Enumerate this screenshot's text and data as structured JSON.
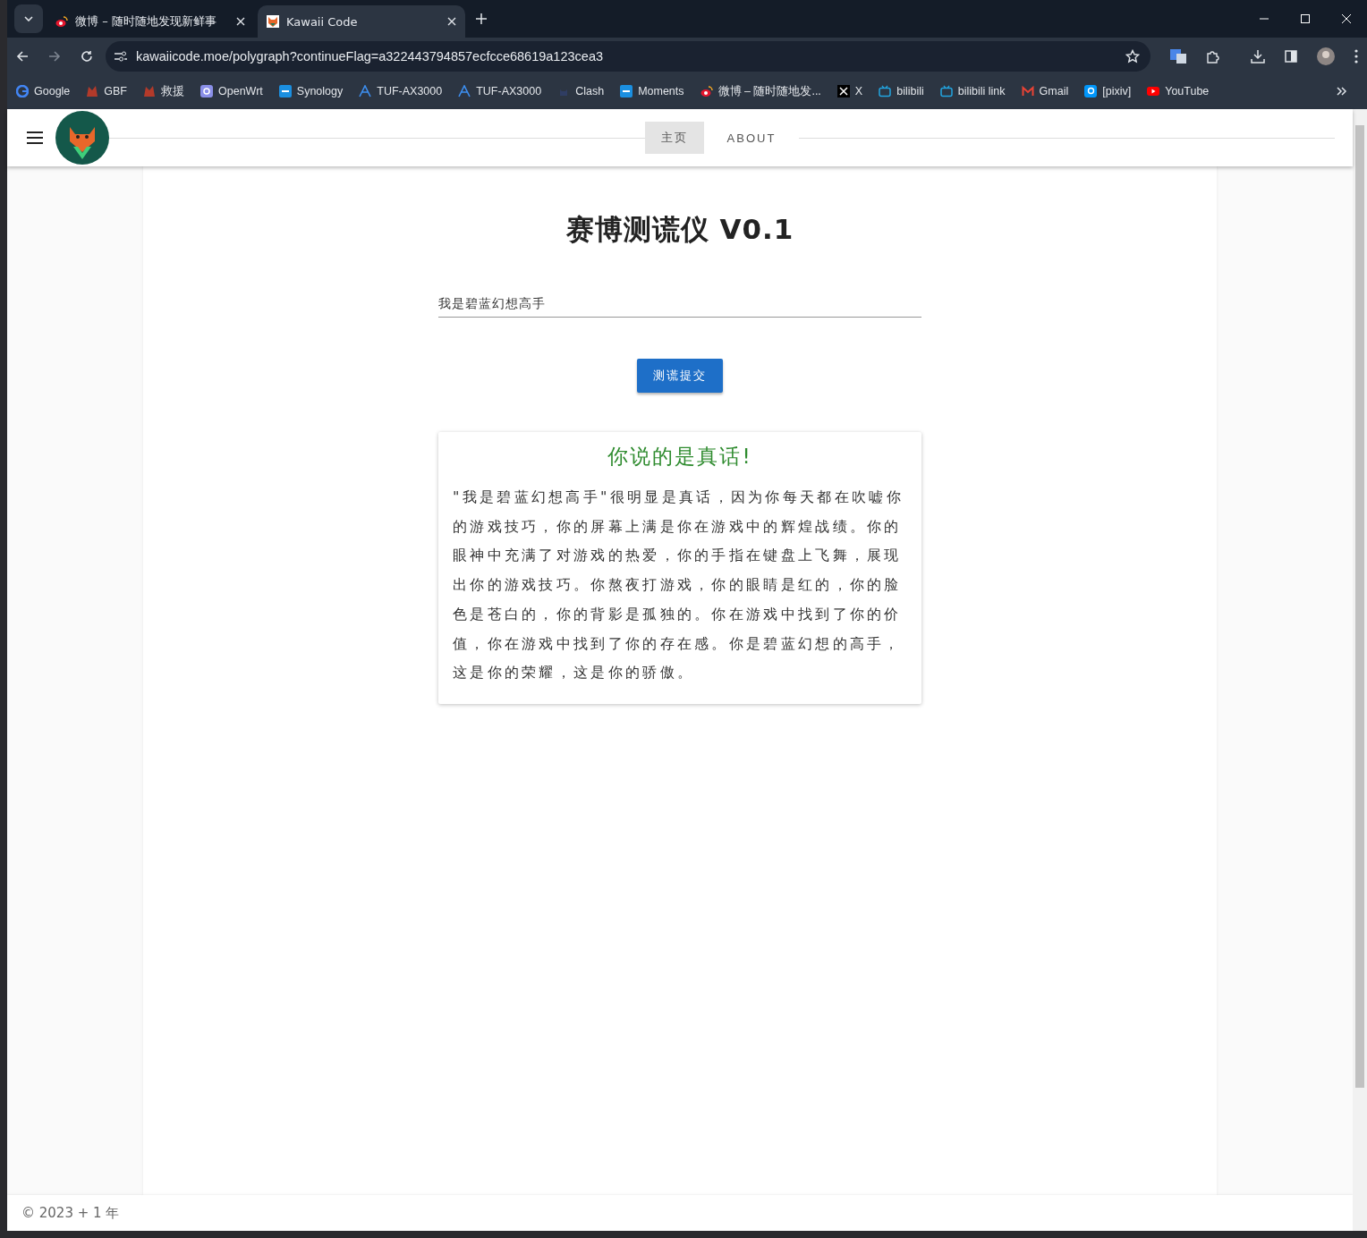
{
  "browser": {
    "tabs": [
      {
        "title": "微博 – 随时随地发现新鲜事",
        "kind": "weibo",
        "selected": false
      },
      {
        "title": "Kawaii Code",
        "kind": "fox",
        "selected": true
      }
    ],
    "url": "kawaiicode.moe/polygraph?continueFlag=a322443794857ecfcce68619a123cea3",
    "bookmarks": [
      {
        "label": "Google",
        "kind": "google"
      },
      {
        "label": "GBF",
        "kind": "gbf"
      },
      {
        "label": "救援",
        "kind": "gbf"
      },
      {
        "label": "OpenWrt",
        "kind": "openwrt"
      },
      {
        "label": "Synology",
        "kind": "dsm"
      },
      {
        "label": "TUF-AX3000",
        "kind": "asus"
      },
      {
        "label": "TUF-AX3000",
        "kind": "asus"
      },
      {
        "label": "Clash",
        "kind": "clash"
      },
      {
        "label": "Moments",
        "kind": "dsm"
      },
      {
        "label": "微博 – 随时随地发...",
        "kind": "weibo"
      },
      {
        "label": "X",
        "kind": "x"
      },
      {
        "label": "bilibili",
        "kind": "bilibili"
      },
      {
        "label": "bilibili link",
        "kind": "bilibili"
      },
      {
        "label": "Gmail",
        "kind": "gmail"
      },
      {
        "label": "[pixiv]",
        "kind": "pixiv"
      },
      {
        "label": "YouTube",
        "kind": "youtube"
      }
    ]
  },
  "nav": [
    {
      "label": "主页",
      "selected": true
    },
    {
      "label": "ABOUT",
      "selected": false
    }
  ],
  "page": {
    "title": "赛博测谎仪 V0.1",
    "input": {
      "value": "我是碧蓝幻想高手"
    },
    "submit": "测谎提交",
    "result": {
      "heading": "你说的是真话!",
      "body": "\"我是碧蓝幻想高手\"很明显是真话，因为你每天都在吹嘘你的游戏技巧，你的屏幕上满是你在游戏中的辉煌战绩。你的眼神中充满了对游戏的热爱，你的手指在键盘上飞舞，展现出你的游戏技巧。你熬夜打游戏，你的眼睛是红的，你的脸色是苍白的，你的背影是孤独的。你在游戏中找到了你的价值，你在游戏中找到了你的存在感。你是碧蓝幻想的高手，这是你的荣耀，这是你的骄傲。"
    }
  },
  "footer": "© 2023 + 1 年"
}
